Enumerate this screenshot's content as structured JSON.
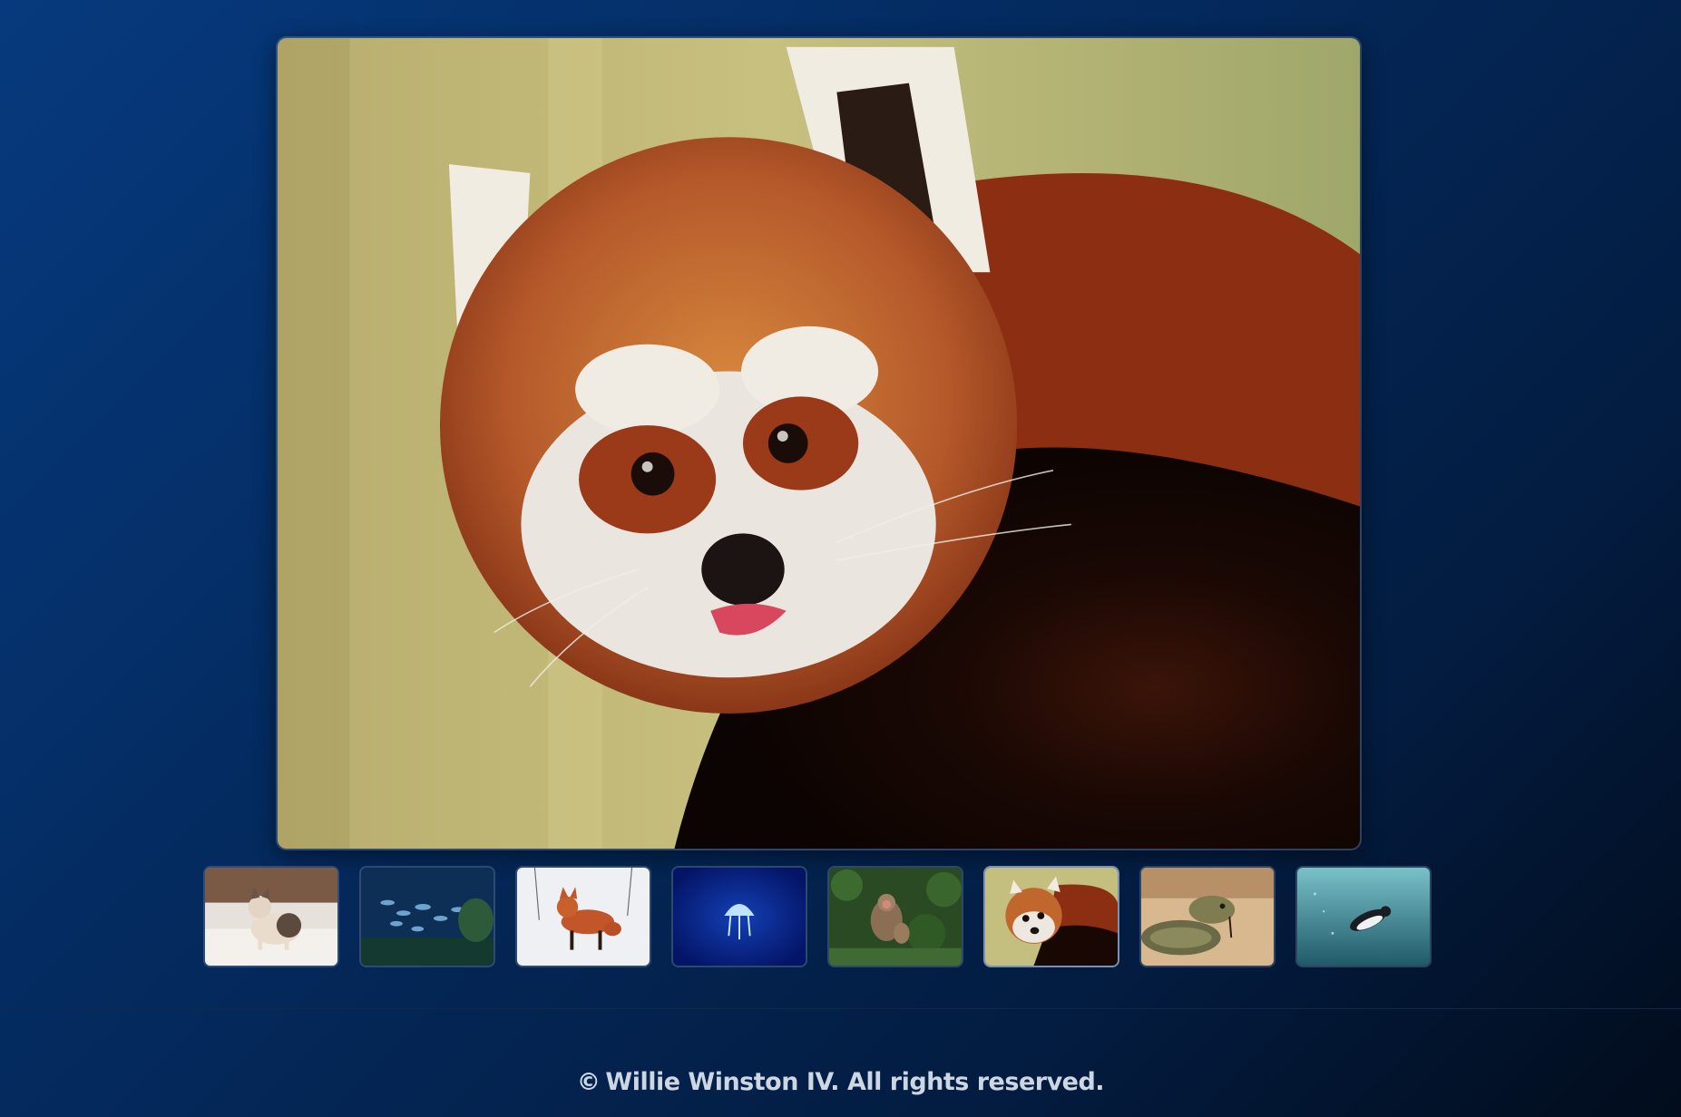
{
  "gallery": {
    "main_image": "red-panda-photo",
    "active_index": 5,
    "thumbnails": [
      {
        "subject": "cat-photo"
      },
      {
        "subject": "fish-school-photo"
      },
      {
        "subject": "fox-in-snow-photo"
      },
      {
        "subject": "jellyfish-photo"
      },
      {
        "subject": "monkeys-photo"
      },
      {
        "subject": "red-panda-photo"
      },
      {
        "subject": "snake-photo"
      },
      {
        "subject": "penguin-photo"
      }
    ]
  },
  "footer": {
    "copyright_symbol": "©",
    "text": "Willie Winston IV. All rights reserved."
  },
  "colors": {
    "background_top": "#063a7e",
    "background_bottom": "#020c1c",
    "footer_text": "#cdd6e3"
  }
}
